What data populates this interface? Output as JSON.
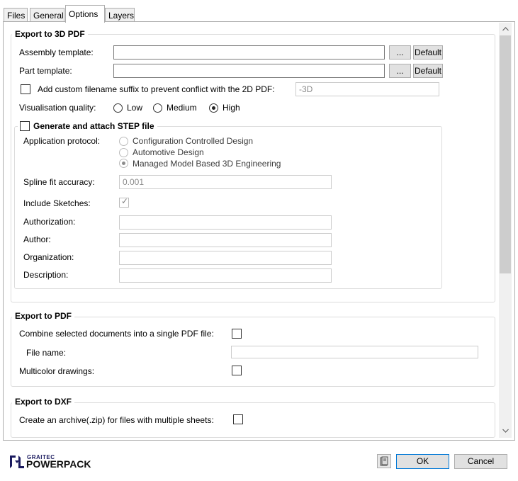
{
  "tabs": [
    "Files",
    "General",
    "Options",
    "Layers"
  ],
  "export3d": {
    "title": "Export to 3D PDF",
    "assembly_label": "Assembly template:",
    "assembly_value": "",
    "part_label": "Part template:",
    "part_value": "",
    "browse_label": "...",
    "default_label": "Default",
    "suffix_label": "Add custom filename suffix to prevent conflict with the 2D PDF:",
    "suffix_value": "-3D",
    "quality_label": "Visualisation quality:",
    "quality_options": [
      "Low",
      "Medium",
      "High"
    ],
    "quality_selected": "High",
    "step": {
      "title": "Generate and attach STEP file",
      "protocol_label": "Application protocol:",
      "protocols": [
        "Configuration Controlled Design",
        "Automotive Design",
        "Managed Model Based 3D Engineering"
      ],
      "protocol_selected": "Managed Model Based 3D Engineering",
      "spline_label": "Spline fit accuracy:",
      "spline_value": "0.001",
      "sketches_label": "Include Sketches:",
      "sketches_checked": true,
      "authorization_label": "Authorization:",
      "author_label": "Author:",
      "organization_label": "Organization:",
      "description_label": "Description:"
    }
  },
  "exportpdf": {
    "title": "Export to PDF",
    "combine_label": "Combine selected documents into a single PDF file:",
    "filename_label": "File name:",
    "filename_value": "",
    "multicolor_label": "Multicolor drawings:"
  },
  "exportdxf": {
    "title": "Export to DXF",
    "archive_label": "Create an archive(.zip) for files with multiple sheets:"
  },
  "footer": {
    "brand_top": "GRAITEC",
    "brand_main": "POWERPACK",
    "ok_label": "OK",
    "cancel_label": "Cancel"
  },
  "colors": {
    "accent": "#0078d7",
    "brand": "#1a1a5e"
  },
  "icons": {
    "scroll_up": "chevron-up-icon",
    "scroll_down": "chevron-down-icon",
    "help": "help-book-icon",
    "logo": "graitec-logo-icon"
  }
}
